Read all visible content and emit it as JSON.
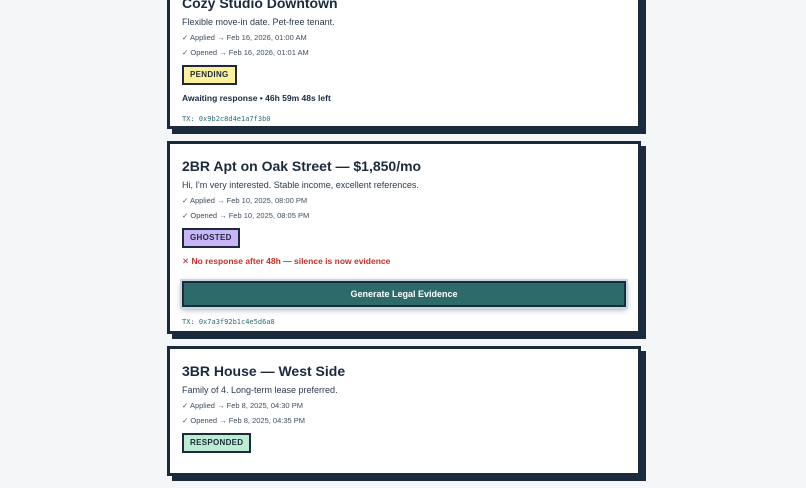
{
  "applications": [
    {
      "title": "Cozy Studio Downtown",
      "message": "Flexible move-in date. Pet-free tenant.",
      "applied": "✓ Applied → Feb 16, 2026, 01:00 AM",
      "opened": "✓ Opened → Feb 16, 2026, 01:01 AM",
      "badge": "PENDING",
      "status": "Awaiting response • 46h 59m 48s left",
      "tx": "TX: 0x9b2c8d4e1a7f3b0"
    },
    {
      "title": "2BR Apt on Oak Street — $1,850/mo",
      "message": "Hi, I'm very interested. Stable income, excellent references.",
      "applied": "✓ Applied → Feb 10, 2025, 08:00 PM",
      "opened": "✓ Opened → Feb 10, 2025, 08:05 PM",
      "badge": "GHOSTED",
      "status": "✕ No response after 48h — silence is now evidence",
      "action": "Generate Legal Evidence",
      "tx": "TX: 0x7a3f92b1c4e5d6a8"
    },
    {
      "title": "3BR House — West Side",
      "message": "Family of 4. Long-term lease preferred.",
      "applied": "✓ Applied → Feb 8, 2025, 04:30 PM",
      "opened": "✓ Opened → Feb 8, 2025, 04:35 PM",
      "badge": "RESPONDED"
    }
  ],
  "colors": {
    "ink": "#1b2a3d",
    "pending": "#fdf29b",
    "ghosted": "#c9b4f6",
    "responded": "#bcecd2",
    "action": "#2d6b6b",
    "alert": "#c0312b",
    "tx": "#2e6d73"
  }
}
